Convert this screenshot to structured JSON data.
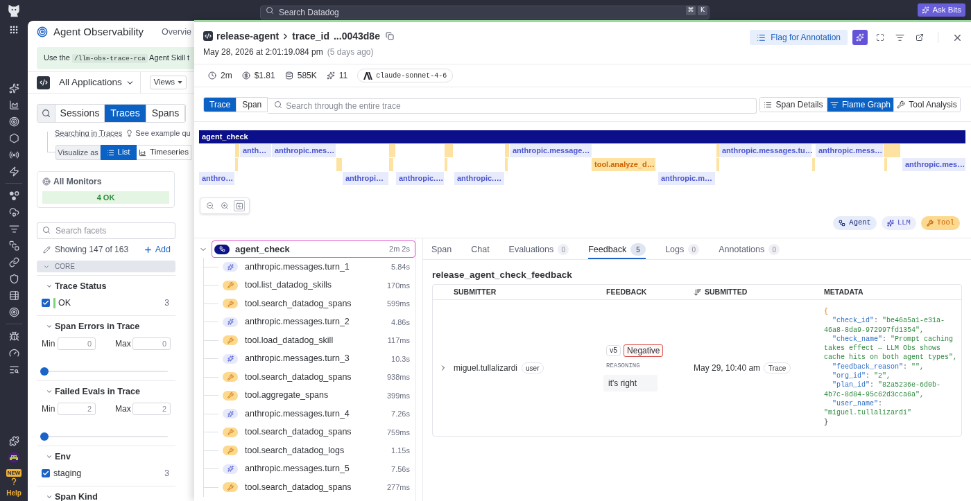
{
  "topbar": {
    "search": {
      "placeholder": "Search Datadog",
      "keys": [
        "⌘",
        "K"
      ]
    },
    "ask_button": "Ask Bits"
  },
  "nav": {
    "new_badge": "NEW",
    "help": "Help"
  },
  "page": {
    "title": "Agent Observability",
    "tab": "Overvie",
    "banner": {
      "before": "Use the",
      "code": "/llm-obs-trace-rca",
      "after": "Agent Skill t"
    },
    "app_selector": "All Applications",
    "views_button": "Views",
    "search_tabs": [
      {
        "label": "Sessions",
        "selected": false
      },
      {
        "label": "Traces",
        "selected": true
      },
      {
        "label": "Spans",
        "selected": false
      }
    ],
    "searching_in": "Searching in Traces",
    "examples_link": "See example qu",
    "visualize_label": "Visualize as",
    "visualize_options": [
      {
        "label": "List",
        "kind": "list",
        "selected": true
      },
      {
        "label": "Timeseries",
        "kind": "timeseries",
        "selected": false
      }
    ],
    "monitors": {
      "title": "All Monitors",
      "status": "4 OK"
    },
    "facet_search": {
      "placeholder": "Search facets"
    },
    "showing": "Showing 147 of 163",
    "add": "Add",
    "group": {
      "label": "CORE",
      "expanded": true
    },
    "facets": [
      {
        "kind": "checklist",
        "title": "Trace Status",
        "expanded": true,
        "options": [
          {
            "label": "OK",
            "count": "3",
            "checked": true,
            "color": "#7fd07f"
          }
        ]
      },
      {
        "kind": "range",
        "title": "Span Errors in Trace",
        "expanded": true,
        "min_label": "Min",
        "min": "0",
        "max_label": "Max",
        "max": "0",
        "level": 0
      },
      {
        "kind": "range",
        "title": "Failed Evals in Trace",
        "expanded": true,
        "min_label": "Min",
        "min": "2",
        "max_label": "Max",
        "max": "2",
        "level": 0
      },
      {
        "kind": "checklist",
        "title": "Env",
        "expanded": true,
        "options": [
          {
            "label": "staging",
            "count": "3",
            "checked": true
          }
        ]
      },
      {
        "kind": "checklist",
        "title": "Span Kind",
        "expanded": true
      }
    ]
  },
  "trace": {
    "header": {
      "app": "release-agent",
      "id_label": "trace_id",
      "id": "...0043d8e",
      "flag_button": "Flag for Annotation",
      "date": "May 28, 2026 at 2:01:19.084 pm",
      "ago": "(5 days ago)"
    },
    "stats": [
      {
        "kind": "duration",
        "value": "2m"
      },
      {
        "kind": "cost",
        "value": "$1.81"
      },
      {
        "kind": "tokens",
        "value": "585K"
      },
      {
        "kind": "llm_calls",
        "value": "11"
      }
    ],
    "model": "claude-sonnet-4-6",
    "scope_tabs": [
      {
        "label": "Trace",
        "selected": true
      },
      {
        "label": "Span",
        "selected": false
      }
    ],
    "search": {
      "placeholder": "Search through the entire trace"
    },
    "views": [
      {
        "label": "Span Details",
        "kind": "details",
        "selected": false
      },
      {
        "label": "Flame Graph",
        "kind": "flame",
        "selected": true
      },
      {
        "label": "Tool Analysis",
        "kind": "tools",
        "selected": false
      }
    ],
    "flame_graph": {
      "rows": [
        [
          {
            "label": "agent_check",
            "kind": "agent"
          }
        ],
        [
          {
            "kind": "tool"
          },
          {
            "label": "anth…",
            "kind": "llm"
          },
          {
            "label": "anthropic.mes…",
            "kind": "llm"
          },
          {
            "kind": "tool"
          },
          {
            "kind": "tool"
          },
          {
            "kind": "tool"
          },
          {
            "label": "anthropic.message…",
            "kind": "llm"
          },
          {
            "kind": "tool"
          },
          {
            "label": "anthropic.messages.tu…",
            "kind": "llm"
          },
          {
            "label": "anthropic.mess…",
            "kind": "llm"
          },
          {
            "kind": "tool"
          }
        ],
        [
          {
            "kind": "tool"
          },
          {
            "kind": "tool"
          },
          {
            "kind": "tool"
          },
          {
            "kind": "tool"
          },
          {
            "kind": "tool"
          },
          {
            "label": "tool.analyze_d…",
            "kind": "tool"
          },
          {
            "kind": "tool"
          },
          {
            "kind": "tool"
          },
          {
            "kind": "tool"
          },
          {
            "label": "anthropic.mes…",
            "kind": "llm"
          }
        ],
        [
          {
            "label": "anthro…",
            "kind": "llm"
          },
          {
            "label": "anthropi…",
            "kind": "llm"
          },
          {
            "label": "anthropic.…",
            "kind": "llm"
          },
          {
            "label": "anthropic.…",
            "kind": "llm"
          },
          {
            "label": "anthropic.m…",
            "kind": "llm"
          }
        ]
      ]
    },
    "legend": [
      {
        "label": "Agent",
        "kind": "agent"
      },
      {
        "label": "LLM",
        "kind": "llm"
      },
      {
        "label": "Tool",
        "kind": "tool"
      }
    ],
    "spans": [
      {
        "name": "agent_check",
        "kind": "agent",
        "duration": "2m 2s",
        "selected": true,
        "expanded": true,
        "children": [
          {
            "name": "anthropic.messages.turn_1",
            "kind": "llm",
            "duration": "5.84s",
            "selected": false
          },
          {
            "name": "tool.list_datadog_skills",
            "kind": "tool",
            "duration": "170ms",
            "selected": false
          },
          {
            "name": "tool.search_datadog_spans",
            "kind": "tool",
            "duration": "599ms",
            "selected": false
          },
          {
            "name": "anthropic.messages.turn_2",
            "kind": "llm",
            "duration": "4.86s",
            "selected": false
          },
          {
            "name": "tool.load_datadog_skill",
            "kind": "tool",
            "duration": "117ms",
            "selected": false
          },
          {
            "name": "anthropic.messages.turn_3",
            "kind": "llm",
            "duration": "10.3s",
            "selected": false
          },
          {
            "name": "tool.search_datadog_spans",
            "kind": "tool",
            "duration": "938ms",
            "selected": false
          },
          {
            "name": "tool.aggregate_spans",
            "kind": "tool",
            "duration": "399ms",
            "selected": false
          },
          {
            "name": "anthropic.messages.turn_4",
            "kind": "llm",
            "duration": "7.26s",
            "selected": false
          },
          {
            "name": "tool.search_datadog_spans",
            "kind": "tool",
            "duration": "759ms",
            "selected": false
          },
          {
            "name": "tool.search_datadog_logs",
            "kind": "tool",
            "duration": "1.15s",
            "selected": false
          },
          {
            "name": "anthropic.messages.turn_5",
            "kind": "llm",
            "duration": "7.56s",
            "selected": false
          },
          {
            "name": "tool.search_datadog_spans",
            "kind": "tool",
            "duration": "277ms",
            "selected": false
          }
        ]
      }
    ]
  },
  "detail": {
    "tabs": [
      {
        "label": "Span",
        "selected": false
      },
      {
        "label": "Chat",
        "selected": false
      },
      {
        "label": "Evaluations",
        "count": "0",
        "selected": false
      },
      {
        "label": "Feedback",
        "count": "5",
        "selected": true
      },
      {
        "label": "Logs",
        "count": "0",
        "selected": false
      },
      {
        "label": "Annotations",
        "count": "0",
        "selected": false
      }
    ],
    "feedback_title": "release_agent_check_feedback",
    "table": {
      "columns": [
        {
          "label": "SUBMITTER",
          "sorted": false
        },
        {
          "label": "FEEDBACK",
          "sorted": false
        },
        {
          "label": "SUBMITTED",
          "sorted": true
        },
        {
          "label": "METADATA",
          "sorted": false
        }
      ],
      "rows": [
        {
          "expanded": false,
          "submitter": "miguel.tullalizardi",
          "submitter_type": "user",
          "version": "v5",
          "feedback": "Negative",
          "reasoning_label": "REASONING",
          "reasoning": "it's right",
          "submitted": "May 29, 10:40 am",
          "scope": "Trace",
          "metadata": {
            "open": "{",
            "entries": [
              {
                "key": "\"check_id\"",
                "value": "\"be46a5a1-e31a-46a8-8da9-972997fd1354\","
              },
              {
                "key": "\"check_name\"",
                "value": "\"Prompt caching takes effect — LLM Obs shows cache hits on both agent types\","
              },
              {
                "key": "\"feedback_reason\"",
                "value": "\"\","
              },
              {
                "key": "\"org_id\"",
                "value": "\"2\","
              },
              {
                "key": "\"plan_id\"",
                "value": "\"82a5236e-6d0b-4b7c-8d84-95c62d3cca6a\","
              },
              {
                "key": "\"user_name\"",
                "value": "\"miguel.tullalizardi\""
              }
            ],
            "separator": ":",
            "close": "}"
          }
        }
      ]
    }
  }
}
